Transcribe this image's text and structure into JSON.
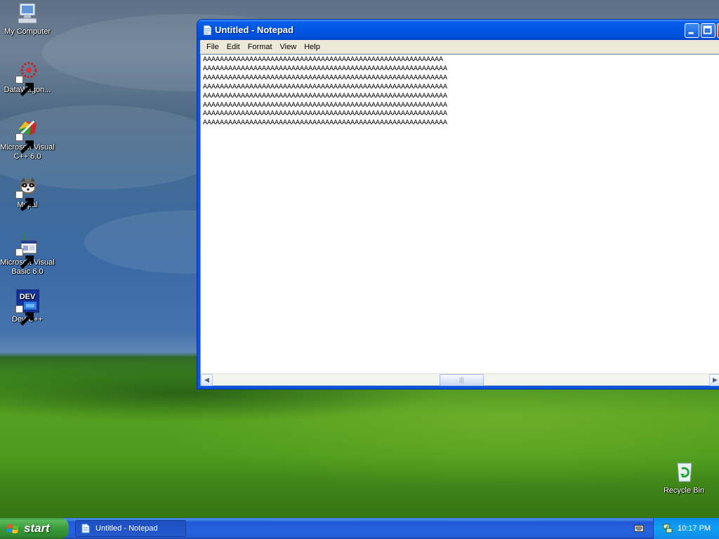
{
  "desktop": {
    "icons": [
      {
        "label": "My Computer"
      },
      {
        "label": "DataWagon..."
      },
      {
        "label": "Microsoft Visual C++ 6.0"
      },
      {
        "label": "Mypal"
      },
      {
        "label": "Microsoft Visual Basic 6.0"
      },
      {
        "label": "Dev-C++",
        "glyph": "DEV"
      },
      {
        "label": "Recycle Bin"
      }
    ]
  },
  "notepad": {
    "title": "Untitled - Notepad",
    "menu": [
      "File",
      "Edit",
      "Format",
      "View",
      "Help"
    ],
    "content": "AAAAAAAAAAAAAAAAAAAAAAAAAAAAAAAAAAAAAAAAAAAAAAAAAAAAAAAAA\nAAAAAAAAAAAAAAAAAAAAAAAAAAAAAAAAAAAAAAAAAAAAAAAAAAAAAAAAAA\nAAAAAAAAAAAAAAAAAAAAAAAAAAAAAAAAAAAAAAAAAAAAAAAAAAAAAAAAAA\nAAAAAAAAAAAAAAAAAAAAAAAAAAAAAAAAAAAAAAAAAAAAAAAAAAAAAAAAAA\nAAAAAAAAAAAAAAAAAAAAAAAAAAAAAAAAAAAAAAAAAAAAAAAAAAAAAAAAAA\nAAAAAAAAAAAAAAAAAAAAAAAAAAAAAAAAAAAAAAAAAAAAAAAAAAAAAAAAAA\nAAAAAAAAAAAAAAAAAAAAAAAAAAAAAAAAAAAAAAAAAAAAAAAAAAAAAAAAAA\nAAAAAAAAAAAAAAAAAAAAAAAAAAAAAAAAAAAAAAAAAAAAAAAAAAAAAAAAAA"
  },
  "taskbar": {
    "start_label": "start",
    "task_label": "Untitled - Notepad",
    "clock": "10:17 PM"
  },
  "colors": {
    "xp_blue": "#0054e3",
    "start_green": "#3a9a3a",
    "tray_blue": "#11a0f2"
  }
}
